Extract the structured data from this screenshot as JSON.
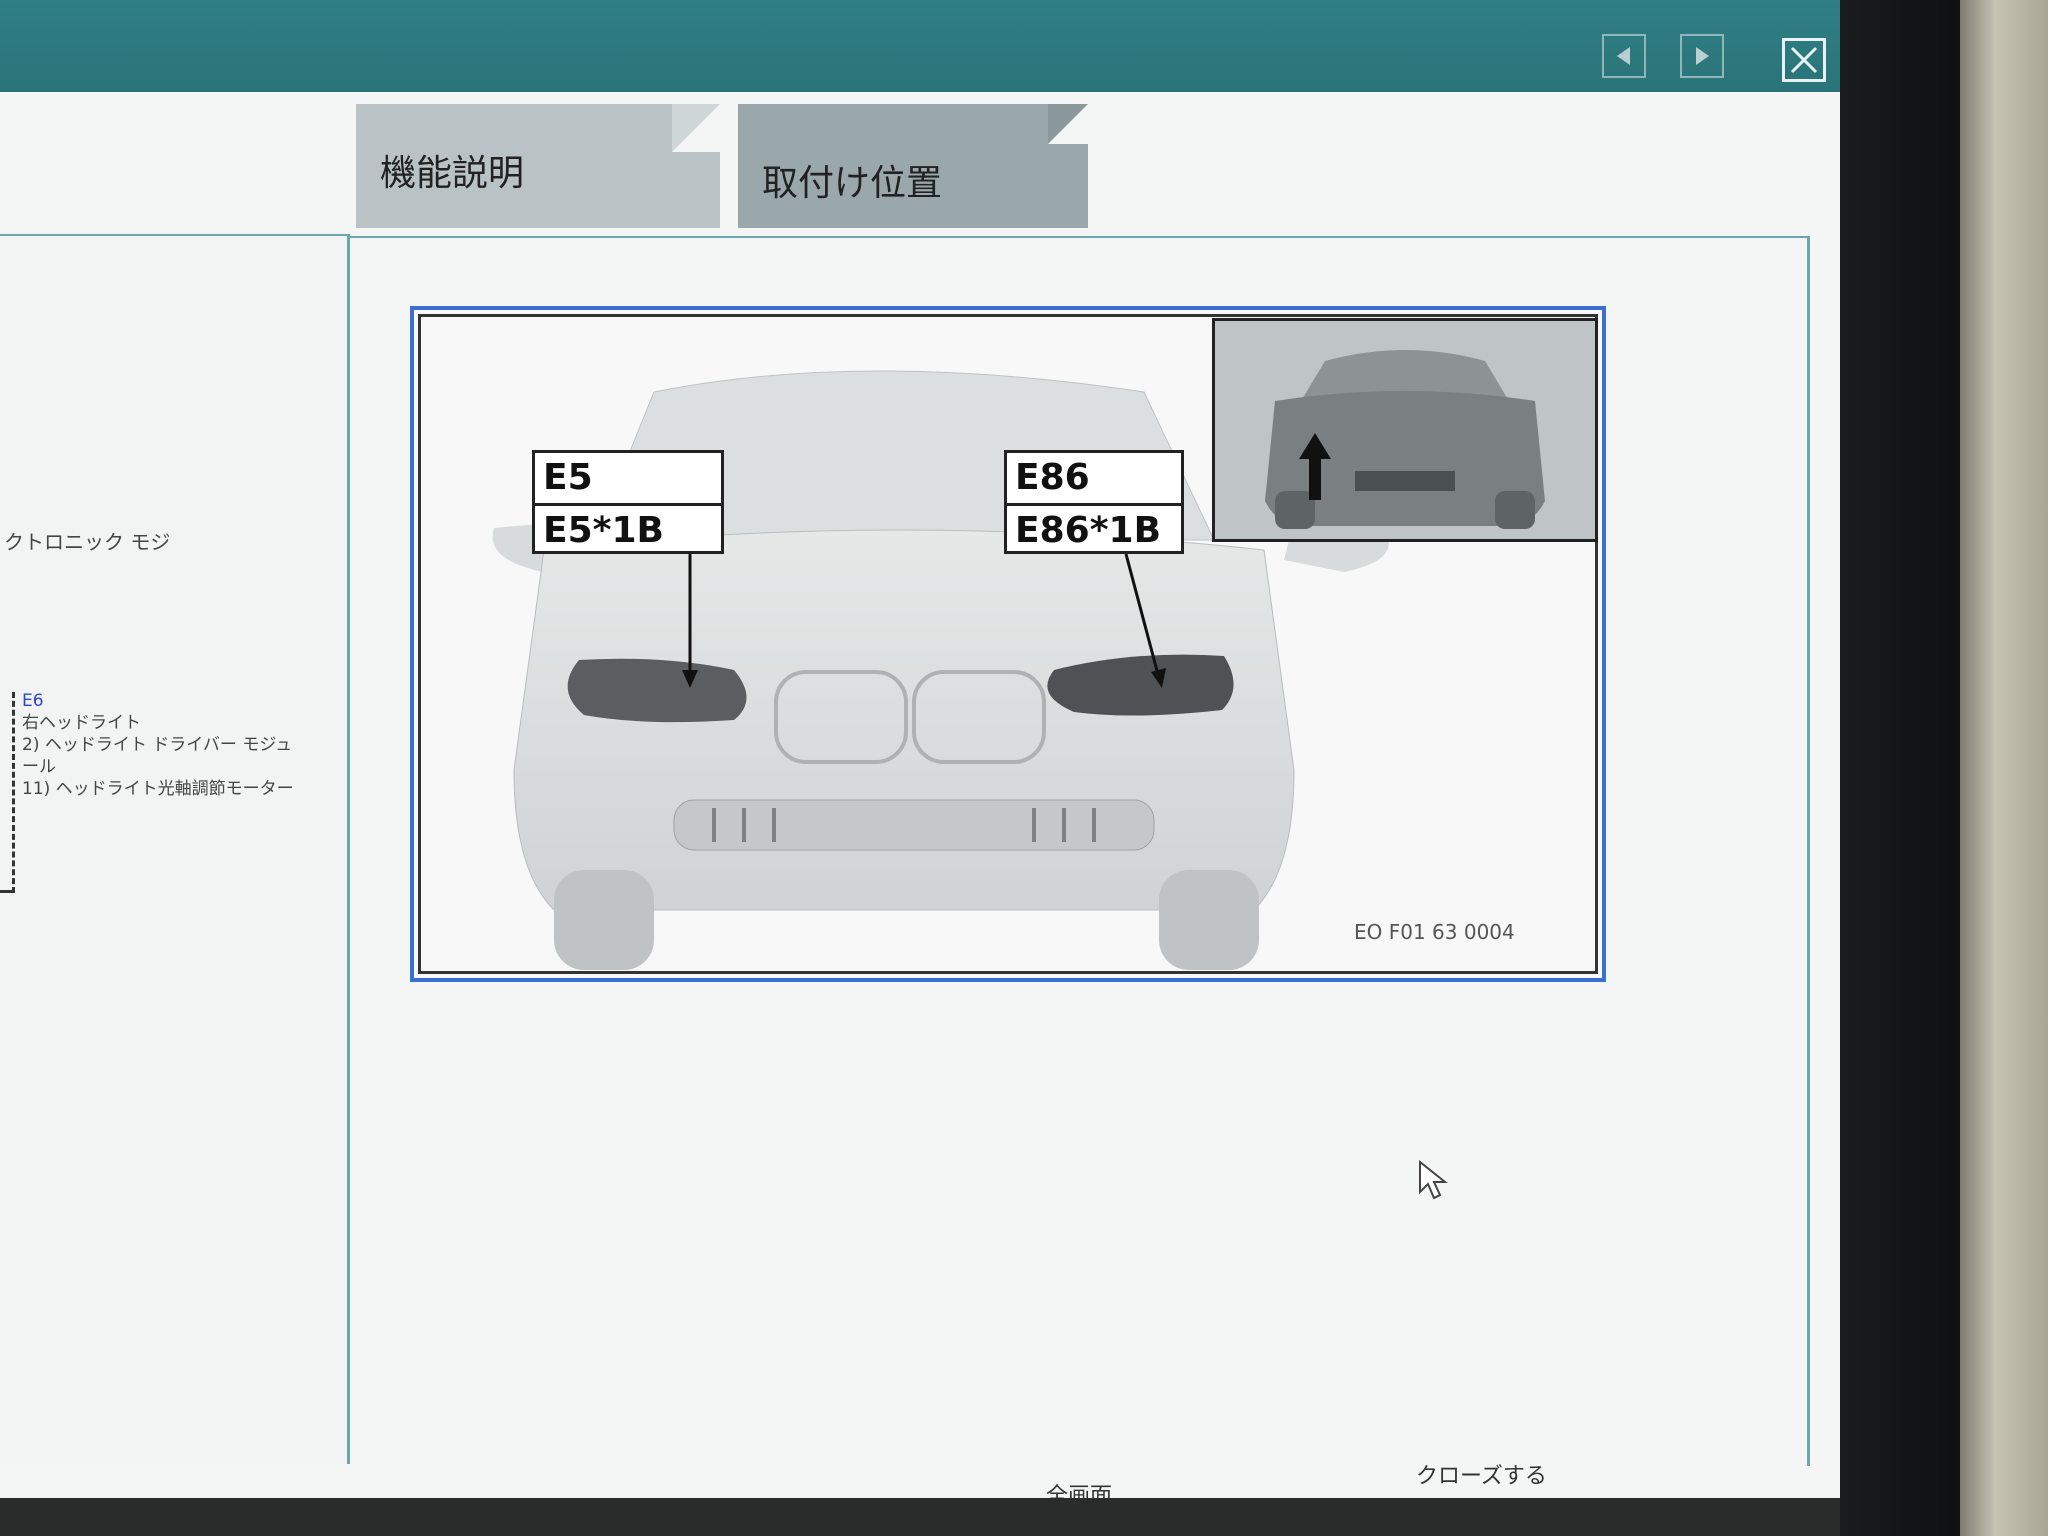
{
  "window": {
    "nav": {
      "prev_icon": "arrow-left-icon",
      "next_icon": "arrow-right-icon"
    },
    "close_icon": "close-icon"
  },
  "tabs": [
    {
      "label": "機能説明"
    },
    {
      "label": "取付け位置"
    }
  ],
  "left_panel": {
    "partial_title": "クトロニック モジ",
    "component_link": "E6",
    "component_name": "右ヘッドライト",
    "items": [
      "2)  ヘッドライト ドライバー モジュ",
      "    ール",
      "11) ヘッドライト光軸調節モーター"
    ]
  },
  "figure": {
    "left_label": {
      "line1": "E5",
      "line2": "E5*1B"
    },
    "right_label": {
      "line1": "E86",
      "line2": "E86*1B"
    },
    "figure_id": "EO F01 63 0004"
  },
  "bottom": {
    "fullscreen_label": "全画面",
    "close_label": "クローズする"
  },
  "colors": {
    "titlebar": "#2f7f85",
    "figure_border": "#3b6fd0",
    "pane_border": "#6aa6ab"
  }
}
